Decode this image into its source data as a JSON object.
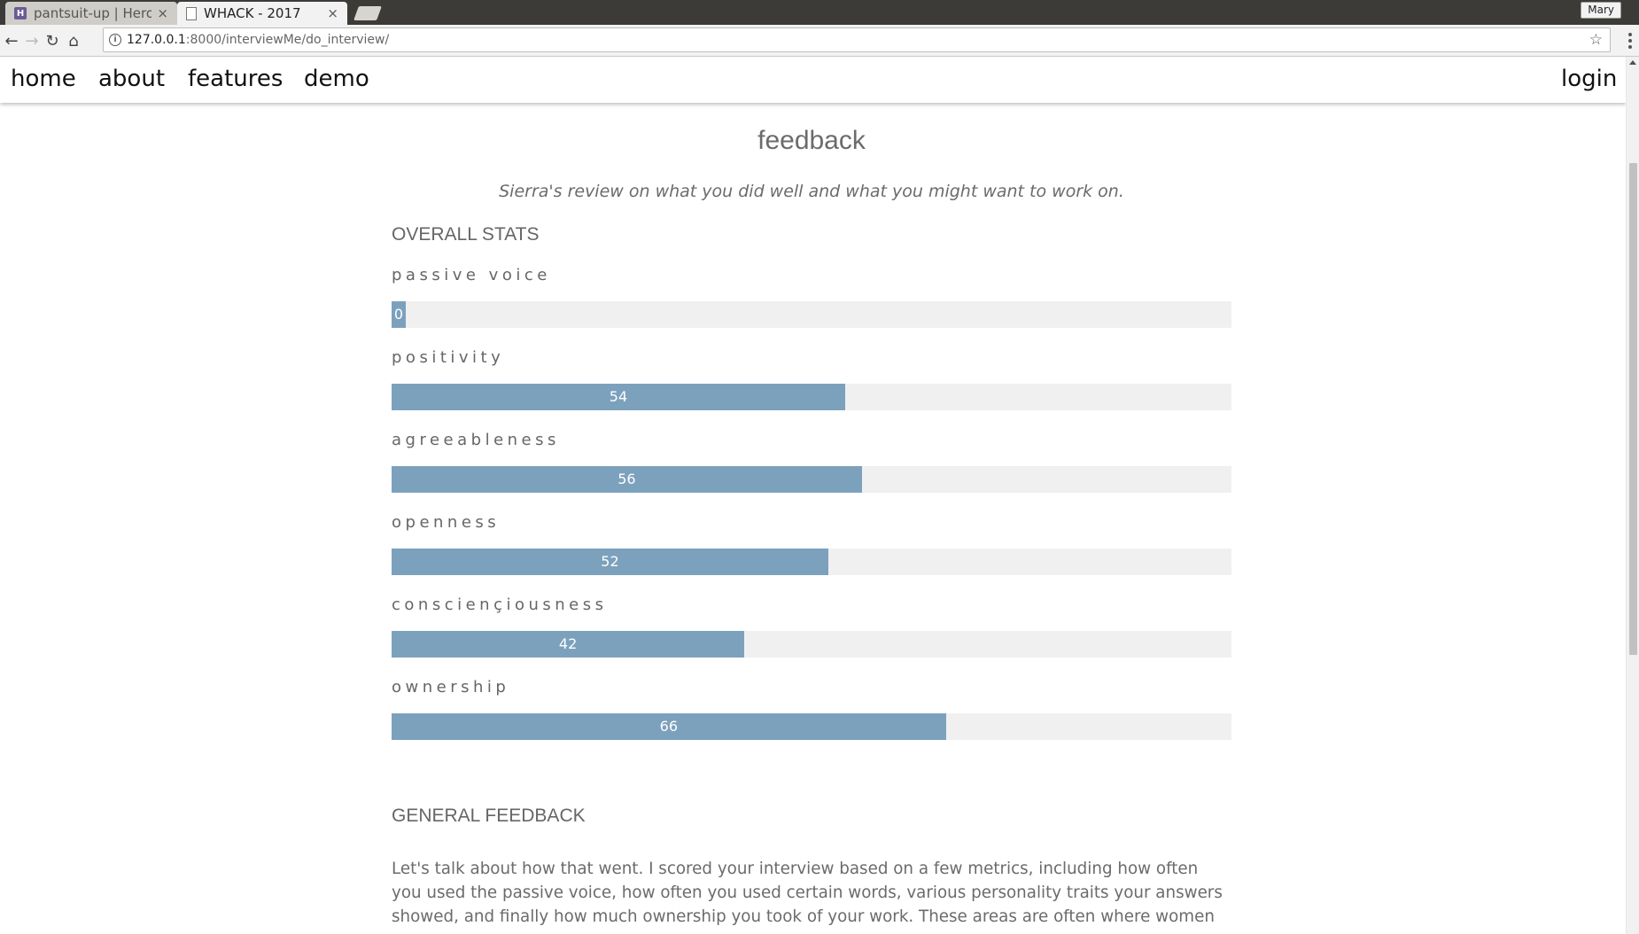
{
  "browser": {
    "tabs": [
      {
        "label": "pantsuit-up | Herok",
        "favicon": "H"
      },
      {
        "label": "WHACK - 2017"
      }
    ],
    "profile": "Mary",
    "url_host": "127.0.0.1",
    "url_rest": ":8000/interviewMe/do_interview/",
    "tab_close_glyph": "×"
  },
  "nav": {
    "home": "home",
    "about": "about",
    "features": "features",
    "demo": "demo",
    "login": "login"
  },
  "page": {
    "title": "feedback",
    "subtitle": "Sierra's review on what you did well and what you might want to work on.",
    "overall_heading": "OVERALL STATS",
    "general_heading": "GENERAL FEEDBACK",
    "general_text": "Let's talk about how that went. I scored your interview based on a few metrics, including how often you used the passive voice, how often you used certain words, various personality traits your answers showed, and finally how much ownership you took of your work. These areas are often where women"
  },
  "stats": [
    {
      "label": "passive voice",
      "value": 0,
      "display": "0"
    },
    {
      "label": "positivity",
      "value": 54,
      "display": "54"
    },
    {
      "label": "agreeableness",
      "value": 56,
      "display": "56"
    },
    {
      "label": "openness",
      "value": 52,
      "display": "52"
    },
    {
      "label": "consciençiousness",
      "value": 42,
      "display": "42"
    },
    {
      "label": "ownership",
      "value": 66,
      "display": "66"
    }
  ],
  "colors": {
    "bar_fill": "#7ca1bd",
    "bar_track": "#f0f0f0",
    "text": "#6b6b6b"
  }
}
